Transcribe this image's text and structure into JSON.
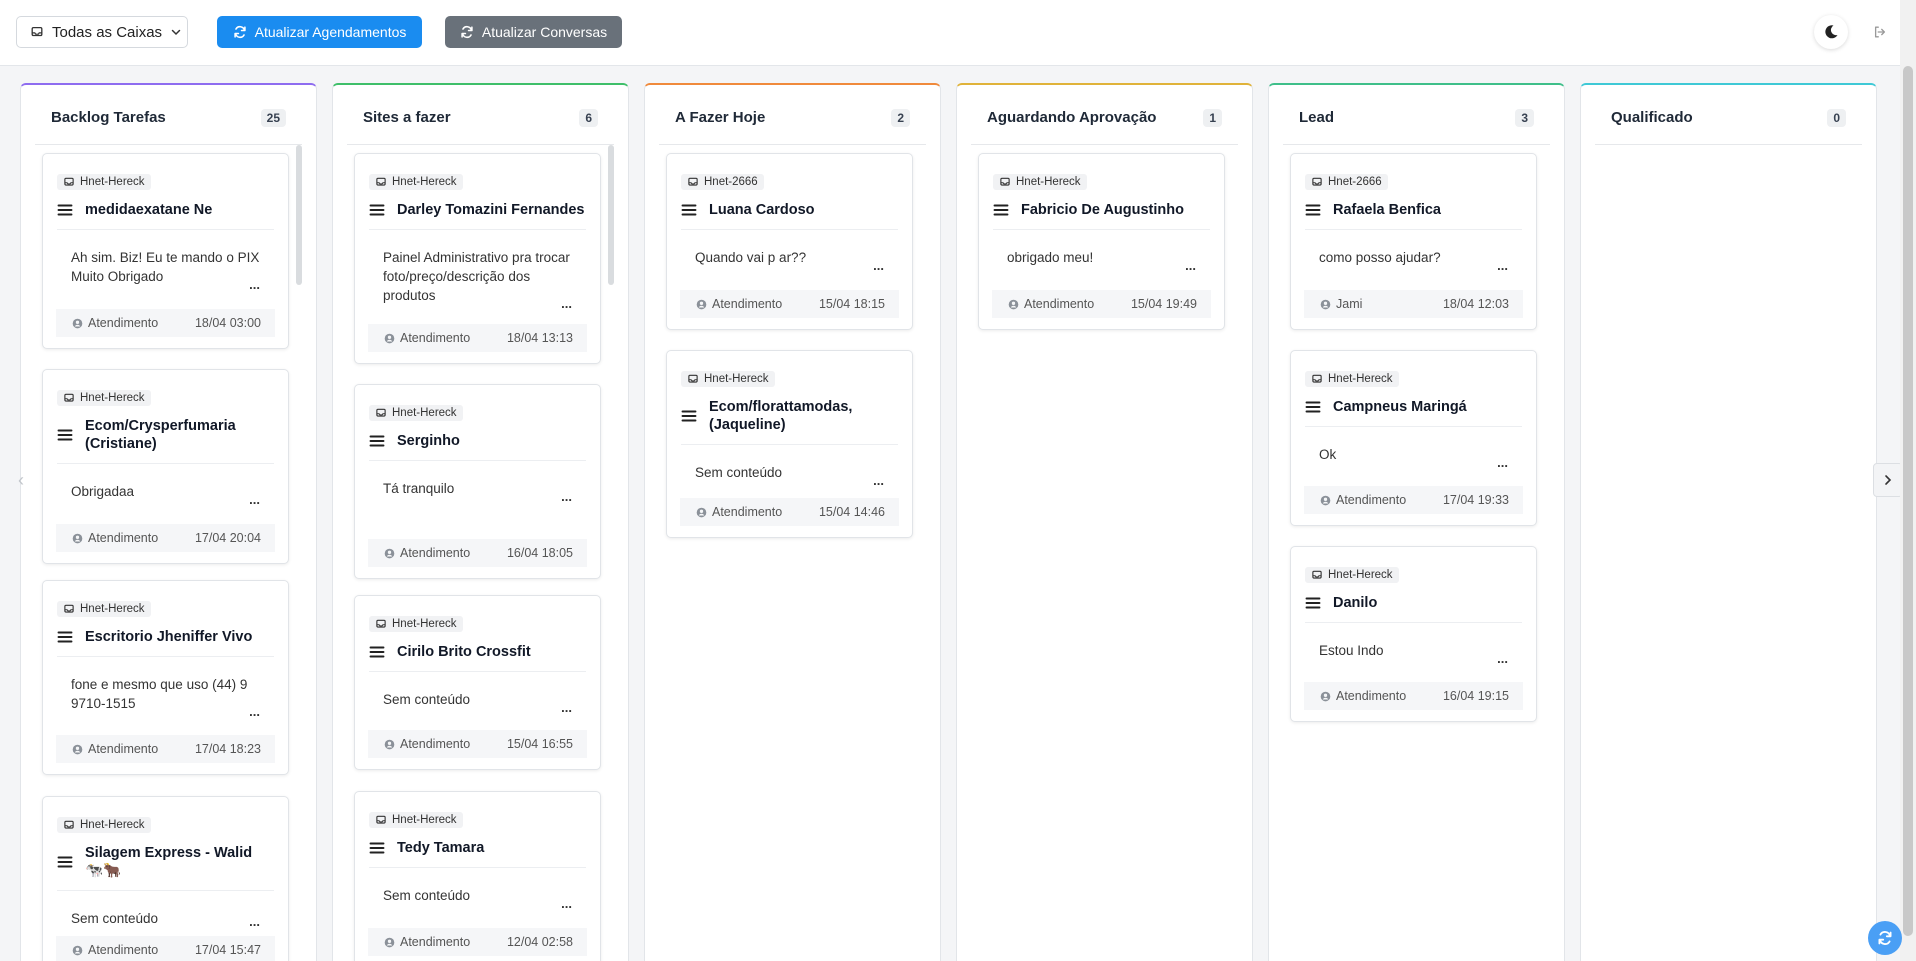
{
  "toolbar": {
    "inbox_select": "Todas as Caixas",
    "update_schedules": "Atualizar Agendamentos",
    "update_conversations": "Atualizar Conversas"
  },
  "colors": {
    "primary": "#1a8cf0",
    "secondary": "#69717a",
    "col_backlog": "#8e6cf0",
    "col_sites": "#3fbf6a",
    "col_hoje": "#f08a3c",
    "col_aguardando": "#e0b33a",
    "col_lead": "#3fbf8a",
    "col_qualificado": "#3fc9d6"
  },
  "icons": {
    "inbox": "inbox-icon",
    "refresh": "refresh-icon",
    "theme": "moon-icon",
    "logout": "logout-icon",
    "menu": "hamburger-icon",
    "agent": "user-circle-icon"
  },
  "columns": [
    {
      "title": "Backlog Tarefas",
      "count": "25",
      "cards": [
        {
          "inbox": "Hnet-Hereck",
          "name": "medidaexatane Ne",
          "message": "Ah sim. Biz! Eu te mando o PIX Muito Obrigado",
          "agent": "Atendimento",
          "time": "18/04 03:00"
        },
        {
          "inbox": "Hnet-Hereck",
          "name": "Ecom/Crysperfumaria (Cristiane)",
          "message": "Obrigadaa",
          "agent": "Atendimento",
          "time": "17/04 20:04"
        },
        {
          "inbox": "Hnet-Hereck",
          "name": "Escritorio Jheniffer Vivo",
          "message": "fone e mesmo que uso (44) 9 9710-1515",
          "agent": "Atendimento",
          "time": "17/04 18:23"
        },
        {
          "inbox": "Hnet-Hereck",
          "name": "Silagem Express - Walid 🐄🐂",
          "message": "Sem conteúdo",
          "agent": "Atendimento",
          "time": "17/04 15:47"
        }
      ]
    },
    {
      "title": "Sites a fazer",
      "count": "6",
      "cards": [
        {
          "inbox": "Hnet-Hereck",
          "name": "Darley Tomazini Fernandes",
          "message": "Painel Administrativo pra trocar foto/preço/descrição dos produtos",
          "agent": "Atendimento",
          "time": "18/04 13:13"
        },
        {
          "inbox": "Hnet-Hereck",
          "name": "Serginho",
          "message": "Tá tranquilo",
          "agent": "Atendimento",
          "time": "16/04 18:05"
        },
        {
          "inbox": "Hnet-Hereck",
          "name": "Cirilo Brito Crossfit",
          "message": "Sem conteúdo",
          "agent": "Atendimento",
          "time": "15/04 16:55"
        },
        {
          "inbox": "Hnet-Hereck",
          "name": "Tedy Tamara",
          "message": "Sem conteúdo",
          "agent": "Atendimento",
          "time": "12/04 02:58"
        }
      ]
    },
    {
      "title": "A Fazer Hoje",
      "count": "2",
      "cards": [
        {
          "inbox": "Hnet-2666",
          "name": "Luana Cardoso",
          "message": "Quando vai p ar??",
          "agent": "Atendimento",
          "time": "15/04 18:15"
        },
        {
          "inbox": "Hnet-Hereck",
          "name": "Ecom/florattamodas, (Jaqueline)",
          "message": "Sem conteúdo",
          "agent": "Atendimento",
          "time": "15/04 14:46"
        }
      ]
    },
    {
      "title": "Aguardando Aprovação",
      "count": "1",
      "cards": [
        {
          "inbox": "Hnet-Hereck",
          "name": "Fabricio De Augustinho",
          "message": "obrigado meu!",
          "agent": "Atendimento",
          "time": "15/04 19:49"
        }
      ]
    },
    {
      "title": "Lead",
      "count": "3",
      "cards": [
        {
          "inbox": "Hnet-2666",
          "name": "Rafaela Benfica",
          "message": "como posso ajudar?",
          "agent": "Jami",
          "time": "18/04 12:03"
        },
        {
          "inbox": "Hnet-Hereck",
          "name": "Campneus Maringá",
          "message": "Ok",
          "agent": "Atendimento",
          "time": "17/04 19:33"
        },
        {
          "inbox": "Hnet-Hereck",
          "name": "Danilo",
          "message": "Estou Indo",
          "agent": "Atendimento",
          "time": "16/04 19:15"
        }
      ]
    },
    {
      "title": "Qualificado",
      "count": "0",
      "cards": []
    }
  ],
  "card_more": "..."
}
